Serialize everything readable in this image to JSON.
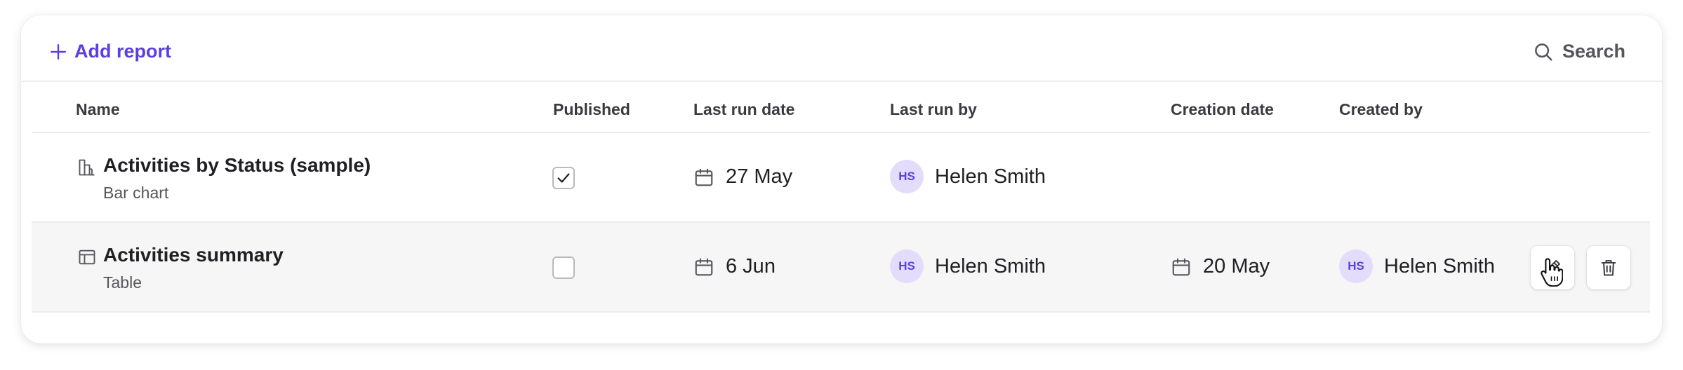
{
  "toolbar": {
    "add_label": "Add report",
    "search_label": "Search"
  },
  "columns": {
    "name": "Name",
    "published": "Published",
    "last_run_date": "Last run date",
    "last_run_by": "Last run by",
    "creation_date": "Creation date",
    "created_by": "Created by"
  },
  "rows": [
    {
      "icon": "bar-chart-icon",
      "title": "Activities by Status (sample)",
      "type": "Bar chart",
      "published": true,
      "last_run_date": "27 May",
      "last_run_by": {
        "initials": "HS",
        "name": "Helen Smith"
      }
    },
    {
      "icon": "table-icon",
      "title": "Activities summary",
      "type": "Table",
      "published": false,
      "last_run_date": "6 Jun",
      "last_run_by": {
        "initials": "HS",
        "name": "Helen Smith"
      },
      "creation_date": "20 May",
      "created_by": {
        "initials": "HS",
        "name": "Helen Smith"
      }
    }
  ],
  "colors": {
    "accent": "#5b3fe0",
    "avatar_bg": "#e4dcfb",
    "hover_row": "#f6f6f7"
  }
}
